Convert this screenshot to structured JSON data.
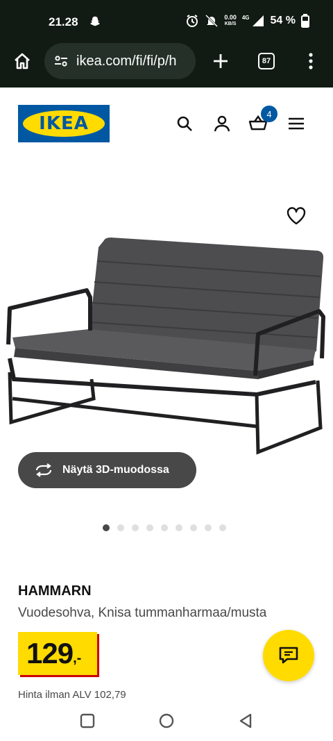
{
  "status": {
    "time": "21.28",
    "net_speed_value": "0.00",
    "net_speed_unit": "KB/S",
    "network_type": "4G",
    "battery": "54 %"
  },
  "browser": {
    "url": "ikea.com/fi/fi/p/h",
    "tab_count": "87"
  },
  "header": {
    "logo_text": "IKEA",
    "cart_count": "4"
  },
  "product": {
    "view_3d_label": "Näytä 3D-muodossa",
    "image_count": 9,
    "active_image_index": 0,
    "name": "HAMMARN",
    "description": "Vuodesohva, Knisa tummanharmaa/musta",
    "price_main": "129",
    "price_suffix": ",-",
    "price_ex_vat": "Hinta ilman ALV 102,79"
  },
  "colors": {
    "brand_blue": "#0058a3",
    "brand_yellow": "#ffdb00",
    "price_red": "#cc0008",
    "dark_button": "#484848"
  },
  "icons": {
    "status_left": "snapchat-icon",
    "status_right": [
      "alarm-icon",
      "mute-icon",
      "signal-icon",
      "battery-icon"
    ],
    "browser": [
      "home-icon",
      "site-settings-icon",
      "plus-icon",
      "tabs-icon",
      "more-vert-icon"
    ],
    "header": [
      "search-icon",
      "account-icon",
      "cart-icon",
      "hamburger-menu-icon"
    ],
    "product": [
      "heart-icon",
      "rotate-3d-icon",
      "chat-icon"
    ],
    "nav": [
      "recents-icon",
      "home-circle-icon",
      "back-icon"
    ]
  }
}
